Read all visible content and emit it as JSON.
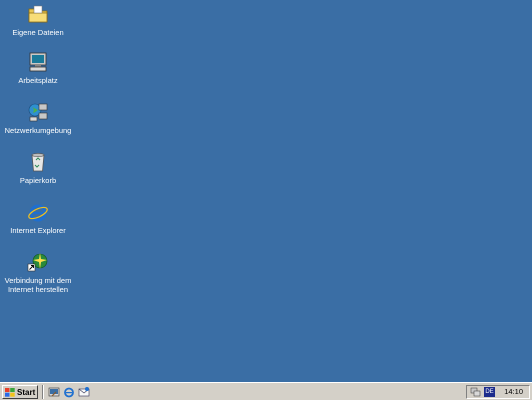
{
  "desktop": {
    "background": "#3a6ea5",
    "icons": [
      {
        "label": "Eigene Dateien",
        "icon": "folder-icon"
      },
      {
        "label": "Arbeitsplatz",
        "icon": "computer-icon"
      },
      {
        "label": "Netzwerkumgebung",
        "icon": "network-icon"
      },
      {
        "label": "Papierkorb",
        "icon": "recycle-bin-icon"
      },
      {
        "label": "Internet Explorer",
        "icon": "internet-explorer-icon"
      },
      {
        "label": "Verbindung mit dem\nInternet herstellen",
        "icon": "connection-wizard-icon"
      }
    ]
  },
  "taskbar": {
    "start_label": "Start",
    "quick_launch": [
      "show-desktop-icon",
      "internet-explorer-icon",
      "outlook-express-icon"
    ],
    "tray": {
      "language": "DE",
      "clock": "14:10"
    }
  }
}
